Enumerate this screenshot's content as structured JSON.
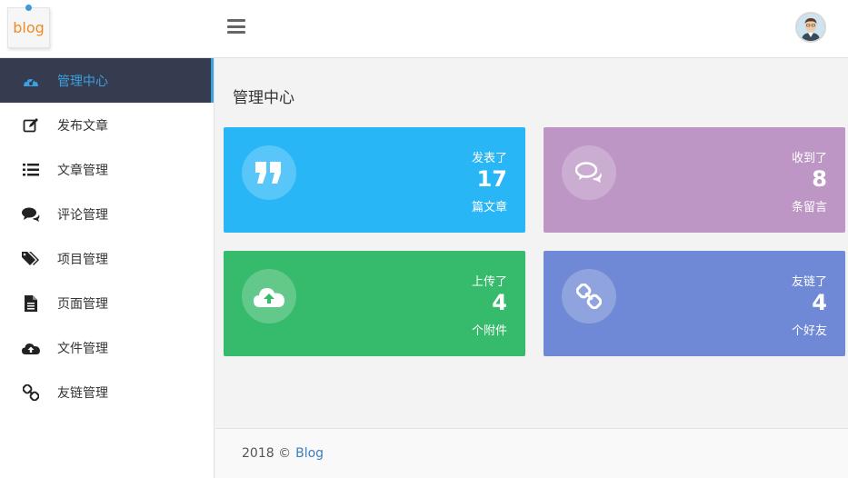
{
  "header": {
    "logo_text": "blog"
  },
  "sidebar": {
    "items": [
      {
        "label": "管理中心",
        "icon": "dashboard-icon"
      },
      {
        "label": "发布文章",
        "icon": "edit-icon"
      },
      {
        "label": "文章管理",
        "icon": "list-icon"
      },
      {
        "label": "评论管理",
        "icon": "comments-icon"
      },
      {
        "label": "项目管理",
        "icon": "tags-icon"
      },
      {
        "label": "页面管理",
        "icon": "file-icon"
      },
      {
        "label": "文件管理",
        "icon": "cloud-upload-icon"
      },
      {
        "label": "友链管理",
        "icon": "link-icon"
      }
    ]
  },
  "main": {
    "title": "管理中心",
    "cards": [
      {
        "top": "发表了",
        "number": "17",
        "bottom": "篇文章",
        "color": "#29b6f6",
        "icon": "quote-icon"
      },
      {
        "top": "收到了",
        "number": "8",
        "bottom": "条留言",
        "color": "#bd96c6",
        "icon": "comments-icon"
      },
      {
        "top": "上传了",
        "number": "4",
        "bottom": "个附件",
        "color": "#36ba6b",
        "icon": "cloud-upload-icon"
      },
      {
        "top": "友链了",
        "number": "4",
        "bottom": "个好友",
        "color": "#7089d6",
        "icon": "link-icon"
      }
    ]
  },
  "footer": {
    "text": "2018 ©",
    "link": "Blog"
  },
  "colors": {
    "sidebar_active_bg": "#363c4f",
    "accent": "#3aa0e0"
  }
}
